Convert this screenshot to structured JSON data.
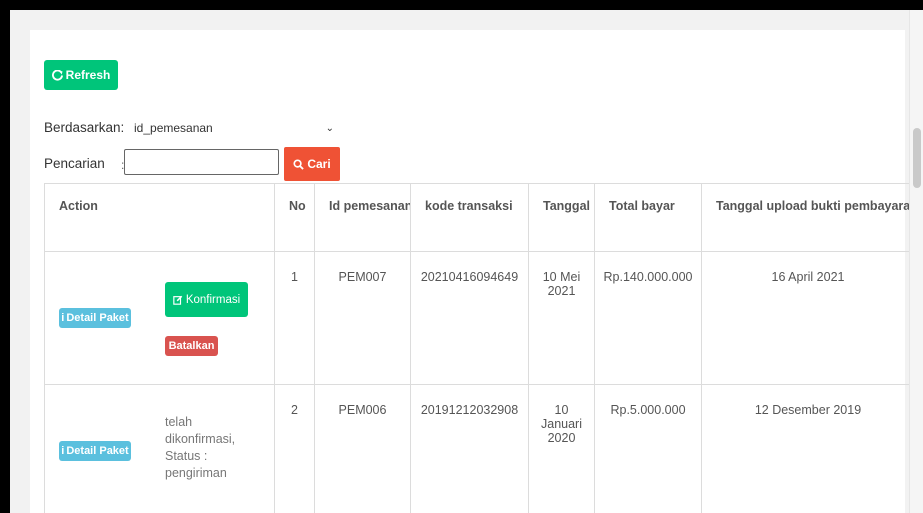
{
  "toolbar": {
    "refresh_label": "Refresh"
  },
  "filter": {
    "berdasarkan_label": "Berdasarkan:",
    "selected_option": "id_pemesanan",
    "pencarian_label": "Pencarian",
    "colon": ":",
    "search_value": "",
    "search_button_label": "Cari"
  },
  "table": {
    "headers": [
      "Action",
      "No",
      "Id pemesanan",
      "kode transaksi",
      "Tanggal Event",
      "Total bayar",
      "Tanggal upload bukti pembayaran"
    ],
    "rows": [
      {
        "detail_label": "Detail Paket",
        "konfirmasi_label": "Konfirmasi",
        "batalkan_label": "Batalkan",
        "no": "1",
        "id": "PEM007",
        "kode": "20210416094649",
        "tanggal_event": "10 Mei 2021",
        "total": "Rp.140.000.000",
        "tanggal_upload": "16 April 2021"
      },
      {
        "detail_label": "Detail Paket",
        "status_text": "telah dikonfirmasi, Status : pengiriman",
        "no": "2",
        "id": "PEM006",
        "kode": "20191212032908",
        "tanggal_event": "10 Januari 2020",
        "total": "Rp.5.000.000",
        "tanggal_upload": "12 Desember 2019"
      }
    ]
  },
  "colors": {
    "green": "#00c57a",
    "info": "#5bc0de",
    "danger": "#d9534f",
    "search": "#ef5235"
  }
}
